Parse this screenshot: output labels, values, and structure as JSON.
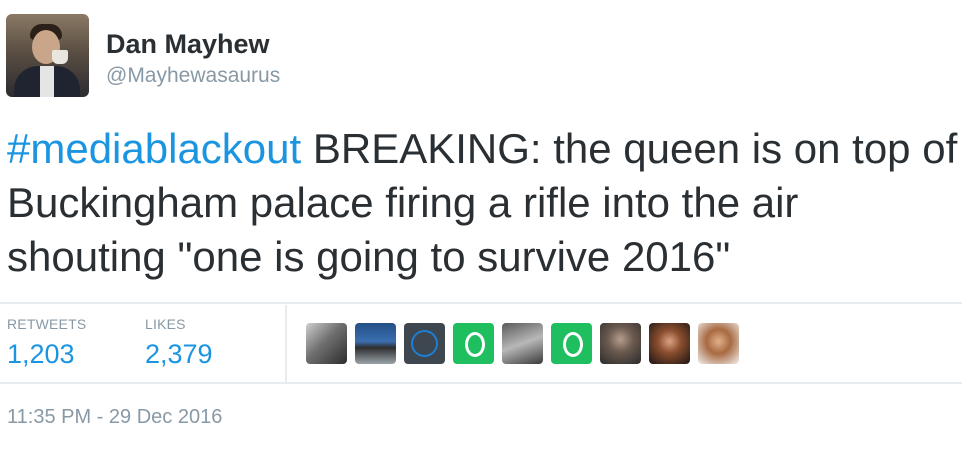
{
  "author": {
    "name": "Dan Mayhew",
    "handle": "@Mayhewasaurus"
  },
  "tweet": {
    "hashtag": "#mediablackout",
    "text": " BREAKING: the queen is on top of Buckingham palace firing a rifle into the air shouting \"one is going to survive 2016\""
  },
  "stats": {
    "retweets_label": "RETWEETS",
    "retweets": "1,203",
    "likes_label": "LIKES",
    "likes": "2,379"
  },
  "likers": [
    "bw-couple",
    "saltire-sea",
    "gauge",
    "green-o",
    "bw-photo",
    "green-o",
    "man-portrait",
    "woman-portrait",
    "woman-portrait-light"
  ],
  "timestamp": "11:35 PM - 29 Dec 2016",
  "colors": {
    "link": "#1b95e0",
    "secondary_text": "#8899a6",
    "primary_text": "#292f33",
    "divider": "#e6ecf0"
  }
}
